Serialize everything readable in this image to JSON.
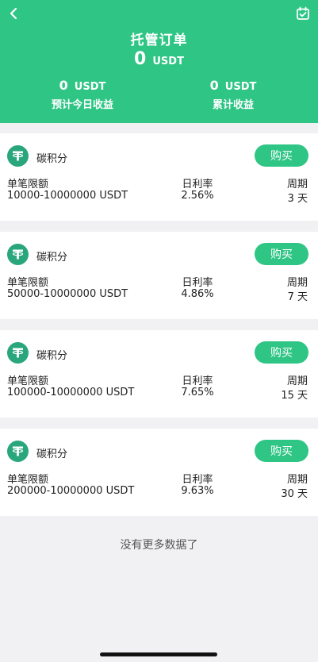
{
  "header": {
    "title": "托管订单",
    "total_value": "0",
    "total_unit": "USDT",
    "today": {
      "value": "0",
      "unit": "USDT",
      "label": "预计今日收益"
    },
    "cumulative": {
      "value": "0",
      "unit": "USDT",
      "label": "累计收益"
    }
  },
  "labels": {
    "limit": "单笔限额",
    "rate": "日利率",
    "period": "周期",
    "buy": "购买"
  },
  "products": [
    {
      "name": "碳积分",
      "limit": "10000-10000000 USDT",
      "rate": "2.56%",
      "period": "3 天"
    },
    {
      "name": "碳积分",
      "limit": "50000-10000000 USDT",
      "rate": "4.86%",
      "period": "7 天"
    },
    {
      "name": "碳积分",
      "limit": "100000-10000000 USDT",
      "rate": "7.65%",
      "period": "15 天"
    },
    {
      "name": "碳积分",
      "limit": "200000-10000000 USDT",
      "rate": "9.63%",
      "period": "30 天"
    }
  ],
  "footer": {
    "no_more": "没有更多数据了"
  },
  "colors": {
    "accent": "#2fc585",
    "logo": "#2aa67d"
  },
  "icons": {
    "back": "chevron-left-icon",
    "calendar": "calendar-check-icon",
    "product": "tether-icon"
  }
}
